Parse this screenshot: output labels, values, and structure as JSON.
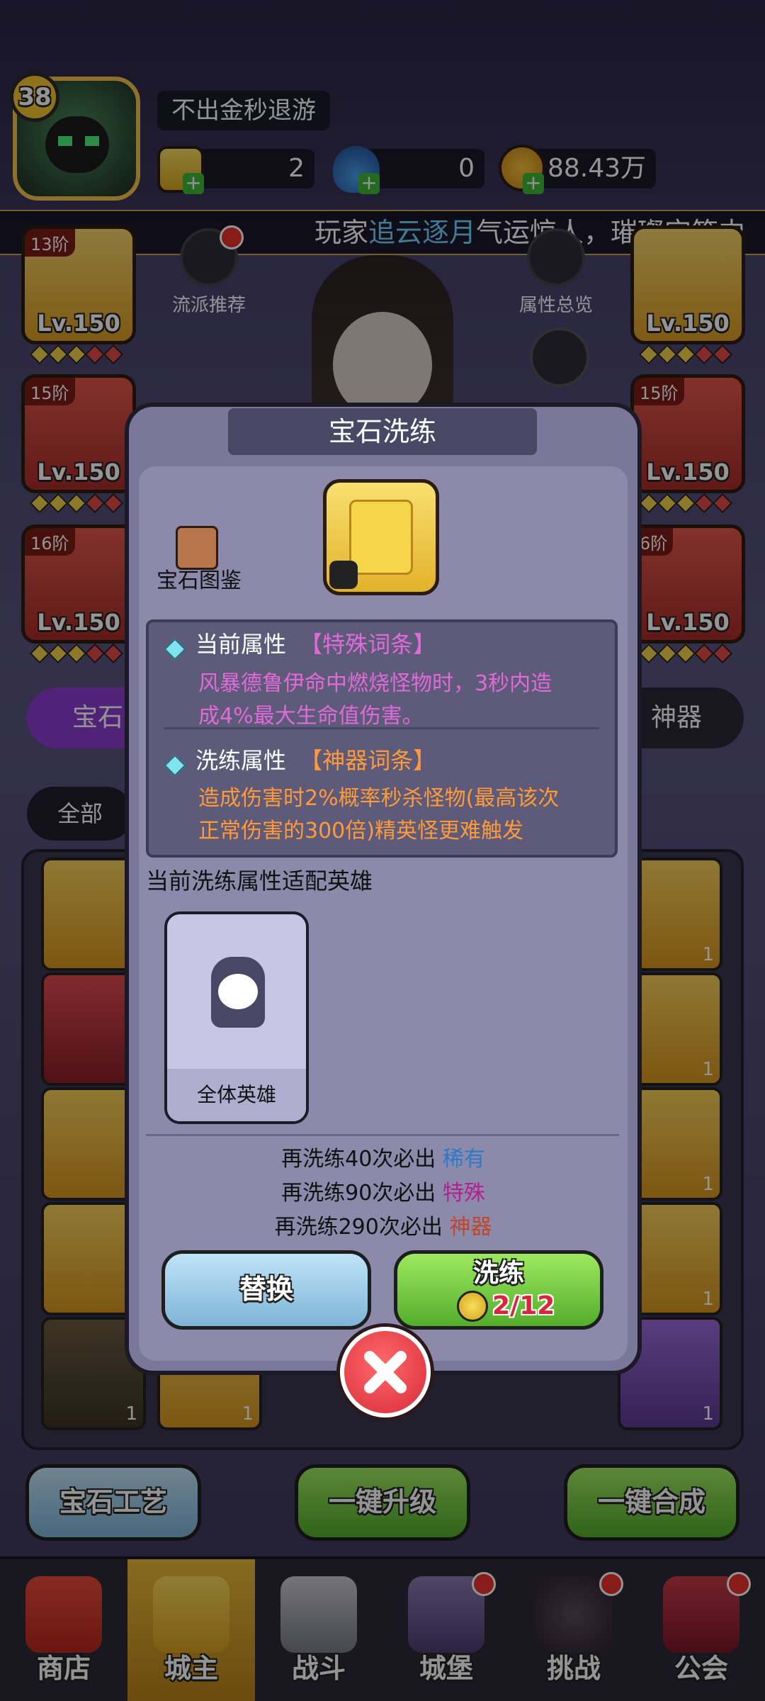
{
  "player": {
    "level": "38",
    "name": "不出金秒退游"
  },
  "resources": {
    "gems": "2",
    "potions": "0",
    "gold": "88.43万"
  },
  "marquee": {
    "prefix": "玩家",
    "player": "追云逐月",
    "suffix": "气运惊人，璀璨宝箱中"
  },
  "top_buttons": {
    "faction": "流派推荐",
    "overview": "属性总览"
  },
  "equipment": {
    "left": [
      {
        "tier": "13阶",
        "level": "Lv.150"
      },
      {
        "tier": "15阶",
        "level": "Lv.150"
      },
      {
        "tier": "16阶",
        "level": "Lv.150"
      }
    ],
    "right": [
      {
        "tier": "",
        "level": "Lv.150"
      },
      {
        "tier": "15阶",
        "level": "Lv.150"
      },
      {
        "tier": "6阶",
        "level": "Lv.150"
      }
    ]
  },
  "tabs": {
    "gem": "宝石",
    "artifact": "神器",
    "filter_all": "全部"
  },
  "grid_counts": {
    "one": "1"
  },
  "bottom_buttons": {
    "craft": "宝石工艺",
    "upgrade": "一键升级",
    "merge": "一键合成"
  },
  "nav": [
    {
      "label": "商店",
      "icon": "shop-icon",
      "active": false,
      "dot": false
    },
    {
      "label": "城主",
      "icon": "crown-icon",
      "active": true,
      "dot": false
    },
    {
      "label": "战斗",
      "icon": "swords-icon",
      "active": false,
      "dot": false
    },
    {
      "label": "城堡",
      "icon": "castle-icon",
      "active": false,
      "dot": true
    },
    {
      "label": "挑战",
      "icon": "demon-icon",
      "active": false,
      "dot": true
    },
    {
      "label": "公会",
      "icon": "guild-book-icon",
      "active": false,
      "dot": true
    }
  ],
  "modal": {
    "title": "宝石洗练",
    "codex_label": "宝石图鉴",
    "current": {
      "label": "当前属性",
      "tag": "【特殊词条】",
      "line1": "风暴德鲁伊命中燃烧怪物时，3秒内造",
      "line2": "成4%最大生命值伤害。"
    },
    "reroll": {
      "label": "洗练属性",
      "tag": "【神器词条】",
      "line1": "造成伤害时2%概率秒杀怪物(最高该次",
      "line2": "正常伤害的300倍)精英怪更难触发"
    },
    "adapt_label": "当前洗练属性适配英雄",
    "hero_card": "全体英雄",
    "pity": [
      {
        "prefix": "再洗练40次必出",
        "rarity": "稀有"
      },
      {
        "prefix": "再洗练90次必出",
        "rarity": "特殊"
      },
      {
        "prefix": "再洗练290次必出",
        "rarity": "神器"
      }
    ],
    "replace_label": "替换",
    "reroll_label": "洗练",
    "reroll_cost": "2/12"
  },
  "colors": {
    "gold": "#f3c24a",
    "special_purple": "#e06ad8",
    "artifact_orange": "#ff9a3a",
    "rare_blue": "#2b7bc8"
  }
}
